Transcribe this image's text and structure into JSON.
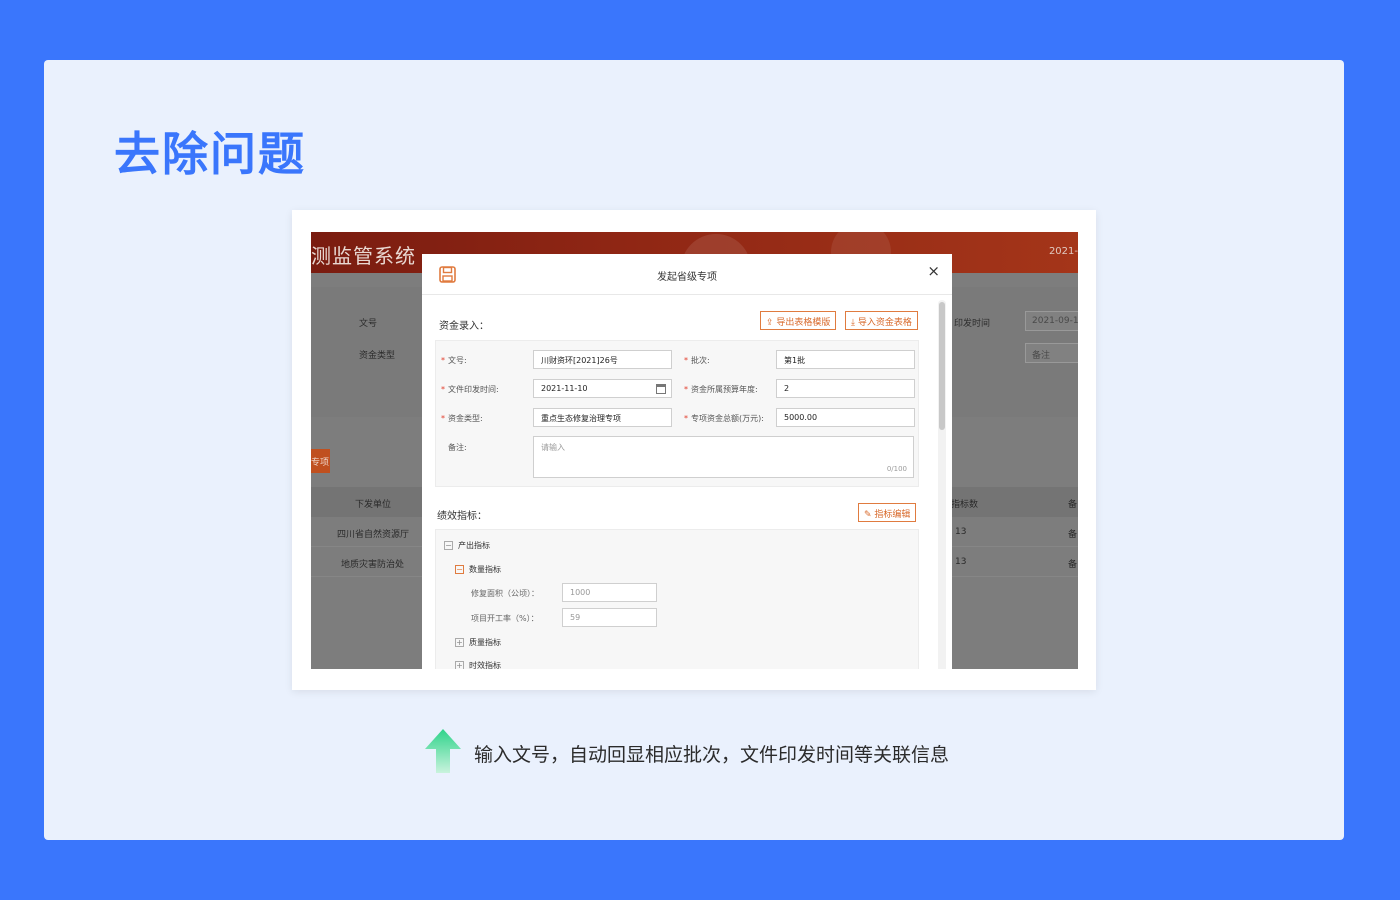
{
  "page": {
    "title": "去除问题",
    "caption": "输入文号，自动回显相应批次，文件印发时间等关联信息"
  },
  "background_app": {
    "title": "测监管系统",
    "date": "2021-",
    "labels": {
      "doc_no": "文号",
      "fund_type": "资金类型",
      "issue_time": "印发时间",
      "issue_date_value": "2021-09-1",
      "remark_placeholder": "备注"
    },
    "button": "专项",
    "table_headers": {
      "unit": "下发单位",
      "indicator_count": "指标数",
      "remark": "备"
    },
    "rows": [
      {
        "unit": "四川省自然资源厅",
        "count": "13",
        "remark": "备"
      },
      {
        "unit": "地质灾害防治处",
        "count": "13",
        "remark": "备"
      }
    ]
  },
  "modal": {
    "title": "发起省级专项",
    "close": "×",
    "fund_section": "资金录入：",
    "export_btn": "导出表格模版",
    "import_btn": "导入资金表格",
    "fields": {
      "doc_no": {
        "label": "文号:",
        "value": "川财资环[2021]26号"
      },
      "batch": {
        "label": "批次:",
        "value": "第1批"
      },
      "issue_time": {
        "label": "文件印发时间:",
        "value": "2021-11-10"
      },
      "budget_year": {
        "label": "资金所属预算年度:",
        "value": "2"
      },
      "fund_type": {
        "label": "资金类型:",
        "value": "重点生态修复治理专项"
      },
      "total_amount": {
        "label": "专项资金总额(万元):",
        "value": "5000.00"
      },
      "remark": {
        "label": "备注:",
        "placeholder": "请输入",
        "count": "0/100"
      }
    },
    "perf_section": "绩效指标：",
    "edit_btn": "指标编辑",
    "tree": {
      "output": "产出指标",
      "quantity": "数量指标",
      "repair_area_label": "修复面积（公顷）：",
      "repair_area_value": "1000",
      "start_rate_label": "项目开工率（%）：",
      "start_rate_value": "59",
      "quality": "质量指标",
      "timeliness": "时效指标"
    }
  },
  "colors": {
    "brand": "#3a76fc",
    "accent_orange": "#e07b3f",
    "required": "#e23c2c"
  }
}
